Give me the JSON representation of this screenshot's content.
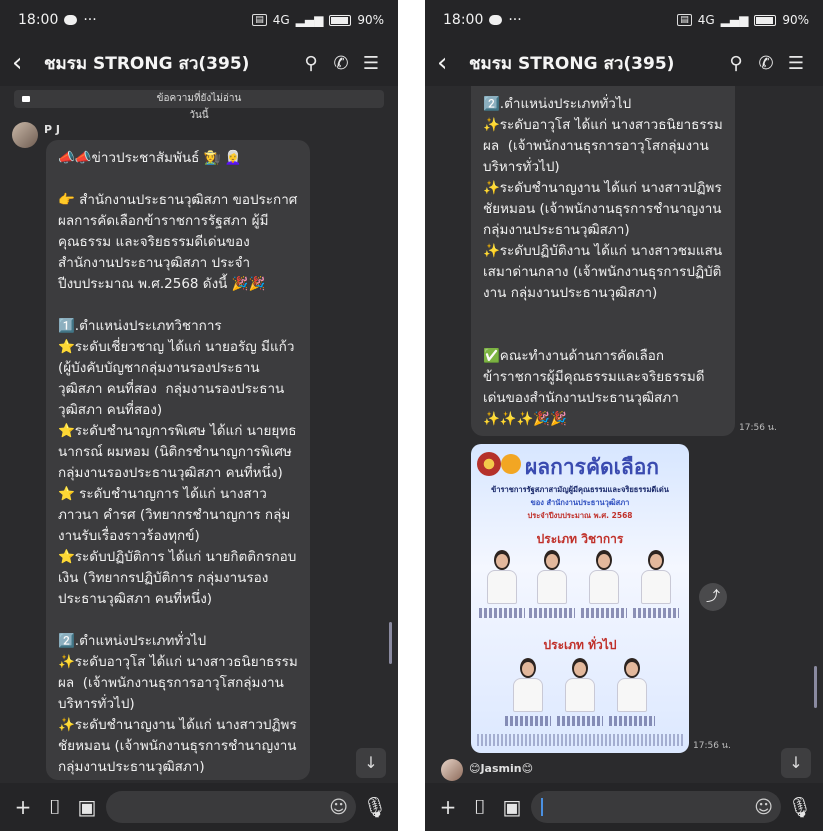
{
  "status": {
    "time": "18:00",
    "more": "···",
    "battery": "90%",
    "network": "4G"
  },
  "header": {
    "title": "ชมรม STRONG สว(395)"
  },
  "left": {
    "unread_banner": "ข้อความที่ยังไม่อ่าน",
    "date_label": "วันนี้",
    "sender": "P J",
    "message": "📣📣ข่าวประชาสัมพันธ์ 👩‍🌾 👩‍🦳\n\n👉 สำนักงานประธานวุฒิสภา ขอประกาศผลการคัดเลือกข้าราชการรัฐสภา ผู้มีคุณธรรม และจริยธรรมดีเด่นของสำนักงานประธานวุฒิสภา ประจำปีงบประมาณ พ.ศ.2568 ดังนี้ 🎉🎉\n\n1️⃣.ตำแหน่งประเภทวิชาการ\n⭐ระดับเชี่ยวชาญ ได้แก่ นายอรัญ มีแก้ว (ผู้บังคับบัญชากลุ่มงานรองประธานวุฒิสภา คนที่สอง  กลุ่มงานรองประธานวุฒิสภา คนที่สอง)\n⭐ระดับชำนาญการพิเศษ ได้แก่ นายยุทธนากรณ์ ผมหอม (นิติกรชำนาญการพิเศษ กลุ่มงานรองประธานวุฒิสภา คนที่หนึ่ง)\n⭐ ระดับชำนาญการ ได้แก่ นางสาวภาวนา คำรศ (วิทยากรชำนาญการ กลุ่มงานรับเรื่องราวร้องทุกข์)\n⭐ระดับปฏิบัติการ ได้แก่ นายกิตติกรกอบเงิน (วิทยากรปฏิบัติการ กลุ่มงานรองประธานวุฒิสภา คนที่หนึ่ง)\n\n2️⃣.ตำแหน่งประเภททั่วไป\n✨ระดับอาวุโส ได้แก่ นางสาวธนิยาธรรมผล  (เจ้าพนักงานธุรการอาวุโสกลุ่มงานบริหารทั่วไป)\n✨ระดับชำนาญงาน ได้แก่ นางสาวปฏิพร ชัยหมอน (เจ้าพนักงานธุรการชำนาญงาน กลุ่มงานประธานวุฒิสภา)\n✨ระดับปฏิบัติงาน ได้แก่ นางสาวชมแสน"
  },
  "right": {
    "message": "2️⃣.ตำแหน่งประเภททั่วไป\n✨ระดับอาวุโส ได้แก่ นางสาวธนิยาธรรมผล  (เจ้าพนักงานธุรการอาวุโสกลุ่มงานบริหารทั่วไป)\n✨ระดับชำนาญงาน ได้แก่ นางสาวปฏิพร ชัยหมอน (เจ้าพนักงานธุรการชำนาญงาน กลุ่มงานประธานวุฒิสภา)\n✨ระดับปฏิบัติงาน ได้แก่ นางสาวชมแสน เสมาด่านกลาง (เจ้าพนักงานธุรการปฏิบัติงาน กลุ่มงานประธานวุฒิสภา)\n\n\n✅คณะทำงานด้านการคัดเลือกข้าราชการผู้มีคุณธรรมและจริยธรรมดีเด่นของสำนักงานประธานวุฒิสภา ✨✨✨🎉🎉",
    "time1": "17:56 น.",
    "time2": "17:56 น.",
    "poster": {
      "title": "ผลการคัดเลือก",
      "line1": "ข้าราชการรัฐสภาสามัญผู้มีคุณธรรมและจริยธรรมดีเด่น",
      "line2": "ของ สำนักงานประธานวุฒิสภา",
      "line3": "ประจำปีงบประมาณ พ.ศ. 2568",
      "cat1": "ประเภท วิชาการ",
      "cat2": "ประเภท ทั่วไป"
    },
    "next_sender": "😊Jasmin😊"
  },
  "colors": {
    "bg": "#2b2b2d",
    "bubble": "#3c3c3e",
    "bar": "#252527",
    "accent": "#4a90e2"
  }
}
